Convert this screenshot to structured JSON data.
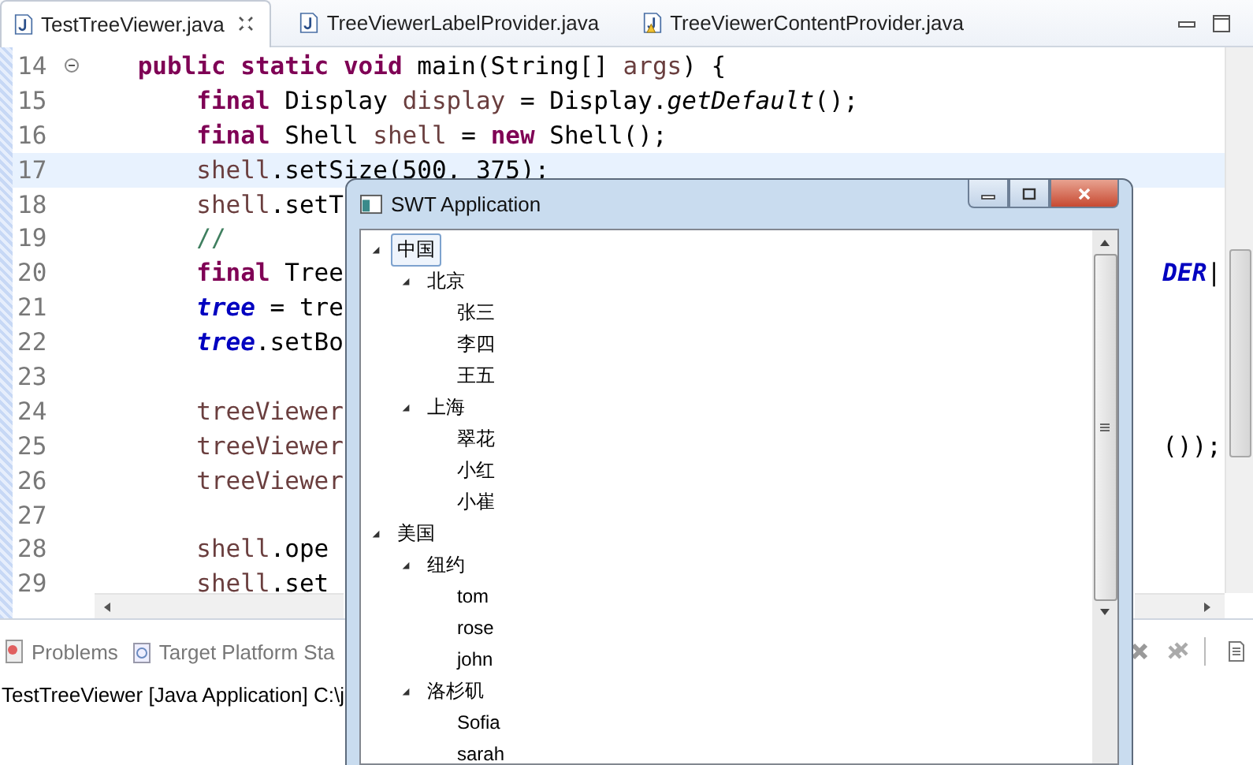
{
  "editor_tabs": [
    {
      "label": "TestTreeViewer.java",
      "selected": true,
      "warning": false
    },
    {
      "label": "TreeViewerLabelProvider.java",
      "selected": false,
      "warning": false
    },
    {
      "label": "TreeViewerContentProvider.java",
      "selected": false,
      "warning": true
    }
  ],
  "code_lines": [
    {
      "number": "14",
      "kind": "signature",
      "fold_marker": true,
      "current": false,
      "tokens": [
        {
          "kind": "kw",
          "text": "public static void"
        },
        {
          "kind": "plain",
          "text": " main(String[] "
        },
        {
          "kind": "var",
          "text": "args"
        },
        {
          "kind": "plain",
          "text": ") {"
        }
      ]
    },
    {
      "number": "15",
      "kind": "statement",
      "fold_marker": false,
      "current": false,
      "tokens": [
        {
          "kind": "kw",
          "text": "final"
        },
        {
          "kind": "plain",
          "text": " Display "
        },
        {
          "kind": "var",
          "text": "display"
        },
        {
          "kind": "plain",
          "text": " = Display."
        },
        {
          "kind": "static",
          "text": "getDefault"
        },
        {
          "kind": "plain",
          "text": "();"
        }
      ]
    },
    {
      "number": "16",
      "kind": "statement",
      "fold_marker": false,
      "current": false,
      "tokens": [
        {
          "kind": "kw",
          "text": "final"
        },
        {
          "kind": "plain",
          "text": " Shell "
        },
        {
          "kind": "var",
          "text": "shell"
        },
        {
          "kind": "plain",
          "text": " = "
        },
        {
          "kind": "kw",
          "text": "new"
        },
        {
          "kind": "plain",
          "text": " Shell();"
        }
      ]
    },
    {
      "number": "17",
      "kind": "statement",
      "fold_marker": false,
      "current": true,
      "tokens": [
        {
          "kind": "var",
          "text": "shell"
        },
        {
          "kind": "plain",
          "text": ".setSize(500, 375);"
        }
      ]
    },
    {
      "number": "18",
      "kind": "statement",
      "fold_marker": false,
      "current": false,
      "tokens": [
        {
          "kind": "var",
          "text": "shell"
        },
        {
          "kind": "plain",
          "text": ".setT"
        }
      ]
    },
    {
      "number": "19",
      "kind": "statement",
      "fold_marker": false,
      "current": false,
      "tokens": [
        {
          "kind": "comment",
          "text": "//"
        }
      ]
    },
    {
      "number": "20",
      "kind": "statement",
      "fold_marker": false,
      "current": false,
      "tokens": [
        {
          "kind": "kw",
          "text": "final"
        },
        {
          "kind": "plain",
          "text": " Tree"
        }
      ],
      "right_tokens": [
        {
          "kind": "field",
          "text": "DER"
        },
        {
          "kind": "plain",
          "text": "|"
        }
      ]
    },
    {
      "number": "21",
      "kind": "statement",
      "fold_marker": false,
      "current": false,
      "tokens": [
        {
          "kind": "field",
          "text": "tree"
        },
        {
          "kind": "plain",
          "text": " = tre"
        }
      ]
    },
    {
      "number": "22",
      "kind": "statement",
      "fold_marker": false,
      "current": false,
      "tokens": [
        {
          "kind": "field",
          "text": "tree"
        },
        {
          "kind": "plain",
          "text": ".setBo"
        }
      ]
    },
    {
      "number": "23",
      "fold_marker": false,
      "current": false
    },
    {
      "number": "24",
      "kind": "statement",
      "fold_marker": false,
      "current": false,
      "tokens": [
        {
          "kind": "var",
          "text": "treeViewer"
        }
      ]
    },
    {
      "number": "25",
      "kind": "statement",
      "fold_marker": false,
      "current": false,
      "tokens": [
        {
          "kind": "var",
          "text": "treeViewer"
        }
      ],
      "right_tokens": [
        {
          "kind": "plain",
          "text": "());"
        }
      ]
    },
    {
      "number": "26",
      "kind": "statement",
      "fold_marker": false,
      "current": false,
      "tokens": [
        {
          "kind": "var",
          "text": "treeViewer"
        }
      ]
    },
    {
      "number": "27",
      "fold_marker": false,
      "current": false
    },
    {
      "number": "28",
      "kind": "statement",
      "fold_marker": false,
      "current": false,
      "tokens": [
        {
          "kind": "var",
          "text": "shell"
        },
        {
          "kind": "plain",
          "text": ".ope"
        }
      ]
    },
    {
      "number": "29",
      "kind": "statement",
      "fold_marker": false,
      "current": false,
      "tokens": [
        {
          "kind": "var",
          "text": "shell"
        },
        {
          "kind": "plain",
          "text": ".set"
        }
      ]
    }
  ],
  "bottom_panel": {
    "tabs": [
      {
        "label": "Problems",
        "kind": "problems"
      },
      {
        "label": "Target Platform Sta",
        "kind": "target"
      }
    ],
    "console_title": "TestTreeViewer [Java Application] C:\\j"
  },
  "swt_window": {
    "title": "SWT Application",
    "tree": [
      {
        "label": "中国",
        "expanded": true,
        "selected": true,
        "children": [
          {
            "label": "北京",
            "expanded": true,
            "selected": false,
            "children": [
              {
                "label": "张三",
                "selected": false
              },
              {
                "label": "李四",
                "selected": false
              },
              {
                "label": "王五",
                "selected": false
              }
            ]
          },
          {
            "label": "上海",
            "expanded": true,
            "selected": false,
            "children": [
              {
                "label": "翠花",
                "selected": false
              },
              {
                "label": "小红",
                "selected": false
              },
              {
                "label": "小崔",
                "selected": false
              }
            ]
          }
        ]
      },
      {
        "label": "美国",
        "expanded": true,
        "selected": false,
        "children": [
          {
            "label": "纽约",
            "expanded": true,
            "selected": false,
            "children": [
              {
                "label": "tom",
                "selected": false
              },
              {
                "label": "rose",
                "selected": false
              },
              {
                "label": "john",
                "selected": false
              }
            ]
          },
          {
            "label": "洛杉矶",
            "expanded": true,
            "selected": false,
            "children": [
              {
                "label": "Sofia",
                "selected": false
              },
              {
                "label": "sarah",
                "selected": false
              }
            ]
          }
        ]
      }
    ]
  }
}
